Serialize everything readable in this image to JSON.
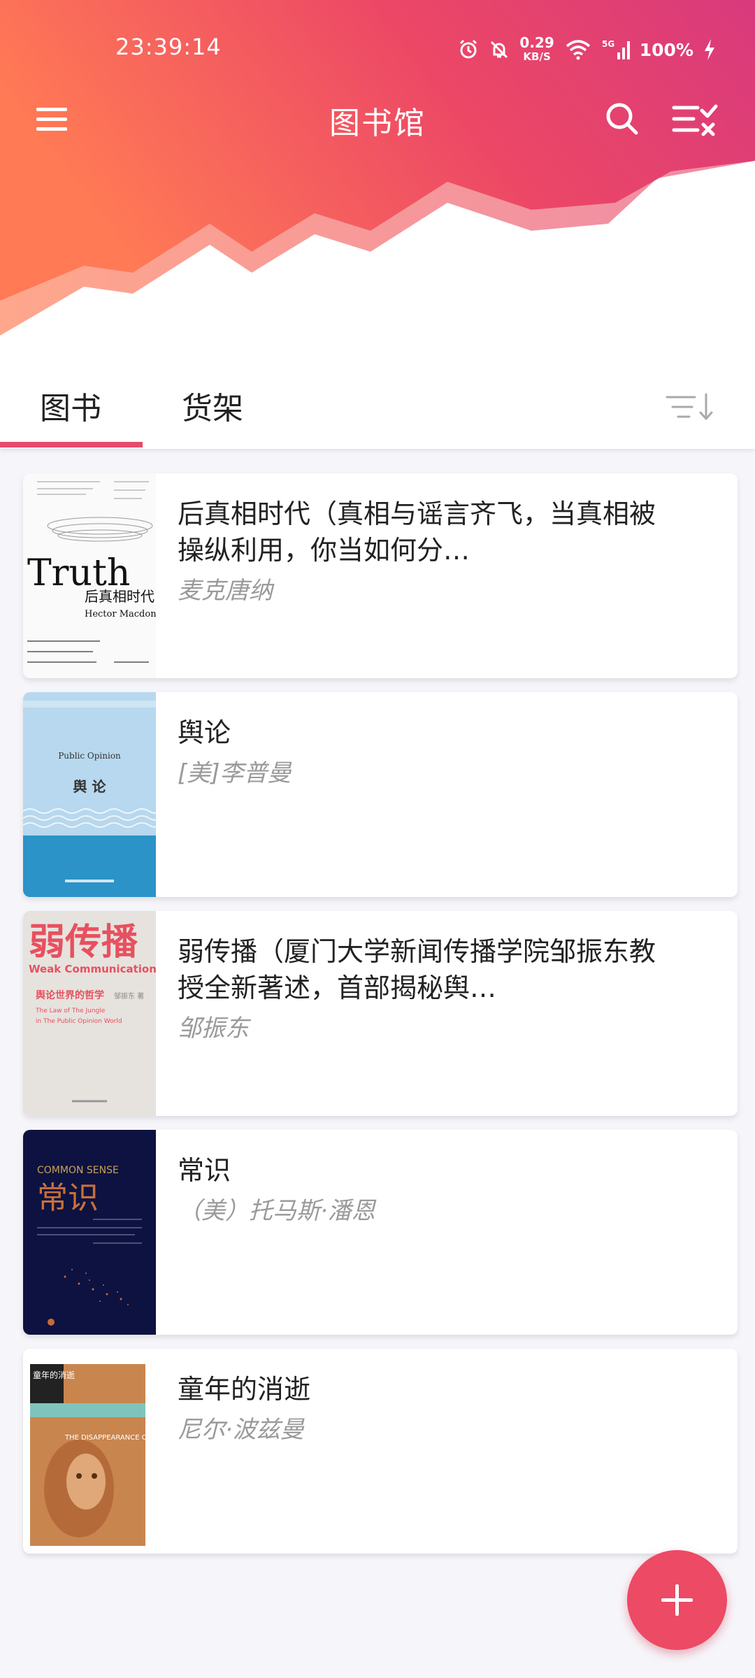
{
  "status_bar": {
    "time": "23:39:14",
    "net_speed": "0.29",
    "net_unit": "KB/S",
    "battery": "100%",
    "icons": [
      "alarm-icon",
      "mute-icon",
      "wifi-icon",
      "signal-5g-icon",
      "charging-icon"
    ]
  },
  "app_bar": {
    "title": "图书馆",
    "gradient": [
      "#ff7a55",
      "#e84a6b",
      "#d23a78"
    ]
  },
  "tabs": {
    "books": "图书",
    "shelf": "货架",
    "active": "books",
    "accent": "#e84a6b"
  },
  "books": [
    {
      "title": "后真相时代（真相与谣言齐飞，当真相被操纵利用，你当如何分…",
      "author": "麦克唐纳",
      "cover_text": [
        "Truth",
        "后真相时代",
        "Hector Macdonald"
      ]
    },
    {
      "title": "舆论",
      "author": "[美]李普曼",
      "cover_text": [
        "Public Opinion",
        "舆 论"
      ]
    },
    {
      "title": "弱传播（厦门大学新闻传播学院邹振东教授全新著述，首部揭秘舆…",
      "author": "邹振东",
      "cover_text": [
        "弱传播",
        "Weak Communication",
        "舆论世界的哲学",
        "The Law of The Jungle",
        "in The Public Opinion World",
        "邹振东 著"
      ]
    },
    {
      "title": "常识",
      "author": "（美）托马斯·潘恩",
      "cover_text": [
        "COMMON SENSE",
        "常识"
      ]
    },
    {
      "title": "童年的消逝",
      "author": "尼尔·波兹曼",
      "cover_text": [
        "童年的消逝",
        "THE DISAPPEARANCE OF CHILDHOOD"
      ]
    }
  ],
  "fab": {
    "color": "#ec4a65",
    "icon": "plus-icon"
  }
}
